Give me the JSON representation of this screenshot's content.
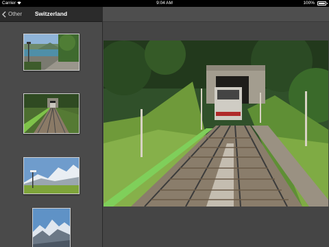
{
  "status_bar": {
    "carrier": "Carrier",
    "time": "9:04 AM",
    "battery_percent": "100%",
    "battery_level": 1.0
  },
  "sidebar": {
    "back_label": "Other",
    "title": "Switzerland",
    "thumbnails": [
      {
        "subject": "lakeside-promenade"
      },
      {
        "subject": "funicular-railway"
      },
      {
        "subject": "mountain-signpost"
      },
      {
        "subject": "snowy-peaks"
      }
    ]
  },
  "main": {
    "photo_subject": "funicular-railway-tunnel"
  },
  "colors": {
    "status_bar_bg": "#000000",
    "sidebar_nav_bg": "#2b2b2b",
    "sidebar_bg": "#4a4a4a",
    "main_bg": "#454545"
  }
}
